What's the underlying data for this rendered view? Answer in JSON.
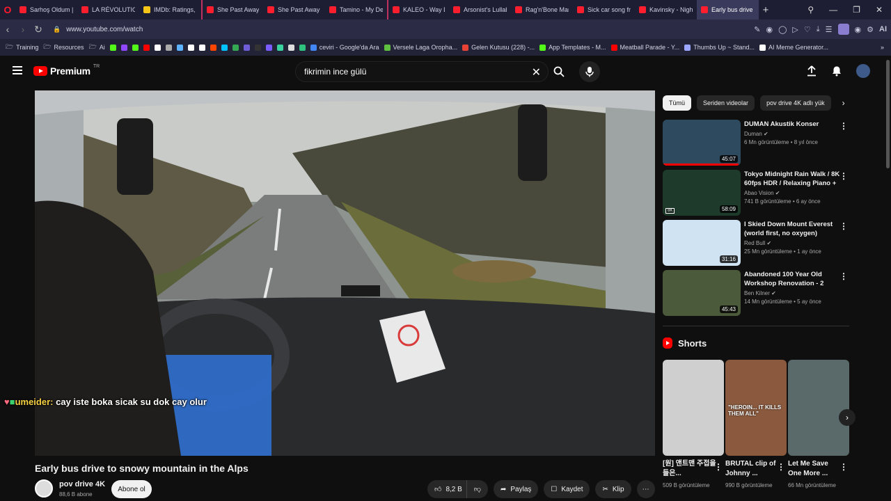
{
  "browser": {
    "tabs": [
      {
        "title": "Sarhoş Oldum | Tol",
        "color": "#ff1e2d"
      },
      {
        "title": "LA RÉVOLUTION FR",
        "color": "#ff1e2d"
      },
      {
        "title": "IMDb: Ratings, Revi",
        "color": "#f5c518"
      },
      {
        "title": "She Past Away - Ka",
        "color": "#ff1e2d"
      },
      {
        "title": "She Past Away - Du",
        "color": "#ff1e2d"
      },
      {
        "title": "Tamino - My Dears",
        "color": "#ff1e2d"
      },
      {
        "title": "KALEO - Way Down",
        "color": "#ff1e2d"
      },
      {
        "title": "Arsonist's Lullaby (",
        "color": "#ff1e2d"
      },
      {
        "title": "Rag'n'Bone Man - I",
        "color": "#ff1e2d"
      },
      {
        "title": "Sick car song from",
        "color": "#ff1e2d"
      },
      {
        "title": "Kavinsky - Nightcal",
        "color": "#ff1e2d"
      },
      {
        "title": "Early bus drive to sno",
        "color": "#ff1e2d"
      }
    ],
    "url": "www.youtube.com/watch",
    "bookmarks": {
      "folders": [
        "Training",
        "Resources",
        "Ai"
      ],
      "icon_colors": [
        "#53fc18",
        "#9146ff",
        "#53fc18",
        "#ff0000",
        "#ffffff",
        "#aaaaaa",
        "#5eb3ff",
        "#ffffff",
        "#ffffff",
        "#ff4500",
        "#00c2ff",
        "#34a853",
        "#6e5dd6",
        "#333333",
        "#7a5cff",
        "#38d39f",
        "#dddddd",
        "#2ec27e"
      ],
      "items": [
        {
          "label": "ceviri - Google'da Ara",
          "color": "#4285f4"
        },
        {
          "label": "Versele Laga Oropha...",
          "color": "#5fbf3f"
        },
        {
          "label": "Gelen Kutusu (228) -...",
          "color": "#ea4335"
        },
        {
          "label": "App Templates - M...",
          "color": "#53fc18"
        },
        {
          "label": "Meatball Parade - Y...",
          "color": "#ff0000"
        },
        {
          "label": "Thumbs Up ~ Stand...",
          "color": "#9aa6ff"
        },
        {
          "label": "AI Meme Generator...",
          "color": "#ffffff"
        }
      ]
    }
  },
  "youtube": {
    "logo_text": "Premium",
    "country_code": "TR",
    "search_value": "fikrimin ince gülü",
    "video": {
      "title": "Early bus drive to snowy mountain in the Alps",
      "channel": "pov drive 4K",
      "subscribers": "88,6 B abone",
      "subscribe_label": "Abone ol",
      "likes": "8,2 B",
      "share_label": "Paylaş",
      "save_label": "Kaydet",
      "clip_label": "Klip"
    },
    "chat": {
      "user": "umeider:",
      "message": "cay iste boka sicak su dok cay olur"
    },
    "chips": [
      "Tümü",
      "Seriden videolar",
      "pov drive 4K adlı yük"
    ],
    "recommendations": [
      {
        "title": "DUMAN Akustik Konser",
        "channel": "Duman",
        "meta": "6 Mn görüntüleme • 8 yıl önce",
        "duration": "45:07",
        "progress": 0.97,
        "badge": ""
      },
      {
        "title": "Tokyo Midnight Rain Walk / 8K 60fps HDR / Relaxing Piano + ...",
        "channel": "Abao Vision",
        "meta": "741 B görüntüleme • 6 ay önce",
        "duration": "58:09",
        "progress": 0,
        "badge": "8K"
      },
      {
        "title": "I Skied Down Mount Everest (world first, no oxygen)",
        "channel": "Red Bull",
        "meta": "25 Mn görüntüleme • 1 ay önce",
        "duration": "31:16",
        "progress": 0,
        "badge": ""
      },
      {
        "title": "Abandoned 100 Year Old Workshop Renovation - 2 Year...",
        "channel": "Ben Kilner",
        "meta": "14 Mn görüntüleme • 5 ay önce",
        "duration": "45:43",
        "progress": 0,
        "badge": ""
      }
    ],
    "shorts_heading": "Shorts",
    "shorts": [
      {
        "title": "[원] 앤트맨 주접을 들은...",
        "views": "509 B görüntüleme",
        "overlay": ""
      },
      {
        "title": "BRUTAL clip of Johnny ...",
        "views": "990 B görüntüleme",
        "overlay": "\"HEROIN... IT KILLS THEM ALL\""
      },
      {
        "title": "Let Me Save One More ...",
        "views": "66 Mn görüntüleme",
        "overlay": ""
      }
    ]
  }
}
